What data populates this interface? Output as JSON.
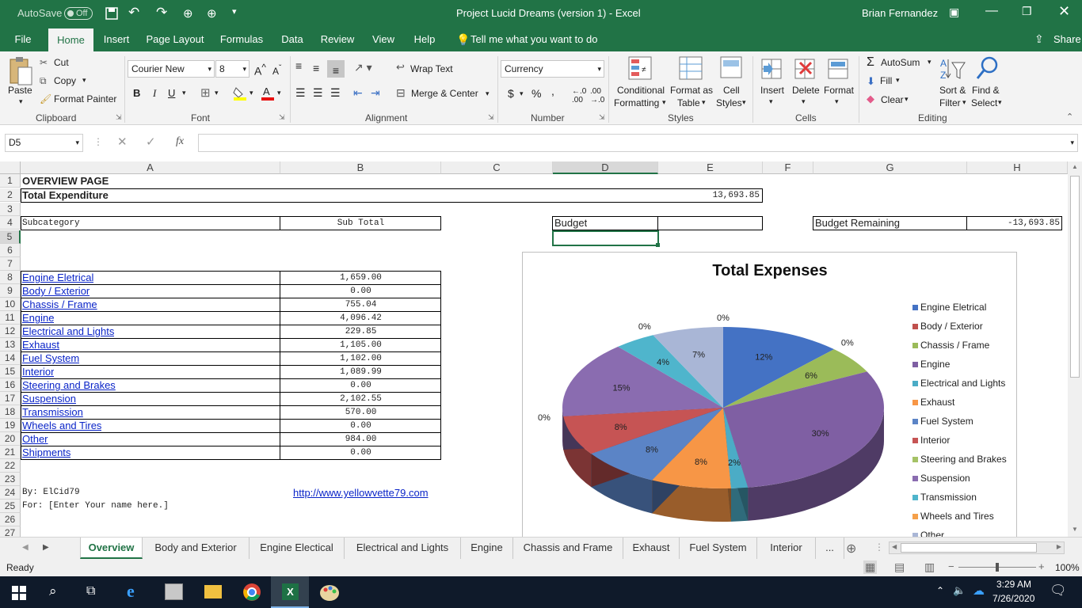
{
  "title_bar": {
    "autosave_label": "AutoSave",
    "autosave_state": "Off",
    "document_title": "Project Lucid Dreams (version 1)  -  Excel",
    "user_name": "Brian Fernandez"
  },
  "menu_tabs": [
    "File",
    "Home",
    "Insert",
    "Page Layout",
    "Formulas",
    "Data",
    "Review",
    "View",
    "Help"
  ],
  "tell_me": "Tell me what you want to do",
  "share_label": "Share",
  "ribbon": {
    "clipboard": {
      "paste": "Paste",
      "cut": "Cut",
      "copy": "Copy",
      "format_painter": "Format Painter",
      "label": "Clipboard"
    },
    "font": {
      "font_name": "Courier New",
      "font_size": "8",
      "bold": "B",
      "italic": "I",
      "underline": "U",
      "label": "Font"
    },
    "alignment": {
      "wrap_text": "Wrap Text",
      "merge_center": "Merge & Center",
      "label": "Alignment"
    },
    "number": {
      "format": "Currency",
      "currency": "$",
      "percent": "%",
      "comma": ",",
      "label": "Number"
    },
    "styles": {
      "conditional": "Conditional",
      "conditional2": "Formatting",
      "format_as": "Format as",
      "format_as2": "Table",
      "cell": "Cell",
      "cell2": "Styles",
      "label": "Styles"
    },
    "cells": {
      "insert": "Insert",
      "delete": "Delete",
      "format": "Format",
      "label": "Cells"
    },
    "editing": {
      "autosum": "AutoSum",
      "fill": "Fill",
      "clear": "Clear",
      "sort": "Sort &",
      "sort2": "Filter",
      "find": "Find &",
      "find2": "Select",
      "label": "Editing"
    }
  },
  "formula_bar": {
    "name_box": "D5",
    "fx": "fx",
    "formula": ""
  },
  "columns": [
    "A",
    "B",
    "C",
    "D",
    "E",
    "F",
    "G",
    "H"
  ],
  "rows": [
    "1",
    "2",
    "3",
    "4",
    "5",
    "6",
    "7",
    "8",
    "9",
    "10",
    "11",
    "12",
    "13",
    "14",
    "15",
    "16",
    "17",
    "18",
    "19",
    "20",
    "21",
    "22",
    "23",
    "24",
    "25",
    "26",
    "27"
  ],
  "sheet": {
    "overview": "OVERVIEW PAGE",
    "total_label": "Total Expenditure",
    "total_value": "13,693.85",
    "subcategory_header": "Subcategory",
    "subtotal_header": "Sub Total",
    "budget_label": "Budget",
    "budget_value": "",
    "remaining_label": "Budget Remaining",
    "remaining_value": "-13,693.85",
    "items": [
      {
        "name": "Engine Eletrical",
        "value": "1,659.00"
      },
      {
        "name": "Body / Exterior",
        "value": "0.00"
      },
      {
        "name": "Chassis / Frame",
        "value": "755.04"
      },
      {
        "name": "Engine",
        "value": "4,096.42"
      },
      {
        "name": "Electrical and Lights",
        "value": "229.85"
      },
      {
        "name": "Exhaust",
        "value": "1,105.00"
      },
      {
        "name": "Fuel System",
        "value": "1,102.00"
      },
      {
        "name": "Interior",
        "value": "1,089.99"
      },
      {
        "name": "Steering and Brakes",
        "value": "0.00"
      },
      {
        "name": "Suspension",
        "value": "2,102.55"
      },
      {
        "name": "Transmission",
        "value": "570.00"
      },
      {
        "name": "Wheels and Tires",
        "value": "0.00"
      },
      {
        "name": "Other",
        "value": "984.00"
      },
      {
        "name": "Shipments",
        "value": "0.00"
      }
    ],
    "by_line": "By: ElCid79",
    "for_line": "For: [Enter Your name here.]",
    "website": "http://www.yellowvette79.com"
  },
  "chart_data": {
    "type": "pie",
    "title": "Total Expenses",
    "legend_position": "right",
    "categories": [
      "Engine Eletrical",
      "Body / Exterior",
      "Chassis / Frame",
      "Engine",
      "Electrical and Lights",
      "Exhaust",
      "Fuel System",
      "Interior",
      "Steering and Brakes",
      "Suspension",
      "Transmission",
      "Wheels and Tires",
      "Other",
      "Shipments"
    ],
    "values": [
      1659.0,
      0.0,
      755.04,
      4096.42,
      229.85,
      1105.0,
      1102.0,
      1089.99,
      0.0,
      2102.55,
      570.0,
      0.0,
      984.0,
      0.0
    ],
    "data_labels": [
      "12%",
      "0%",
      "6%",
      "30%",
      "2%",
      "8%",
      "8%",
      "8%",
      "0%",
      "15%",
      "4%",
      "0%",
      "7%",
      "0%"
    ],
    "colors": [
      "#4472c4",
      "#c0504d",
      "#9bbb59",
      "#7f5fa3",
      "#4bacc6",
      "#f79646",
      "#5b84c6",
      "#c65454",
      "#a5c266",
      "#8a6cb0",
      "#4fb5cc",
      "#f5a04a",
      "#a9b6d6",
      "#d4a2a0"
    ]
  },
  "sheet_tabs": [
    "Overview",
    "Body and Exterior",
    "Engine Electical",
    "Electrical and Lights",
    "Engine",
    "Chassis and Frame",
    "Exhaust",
    "Fuel System",
    "Interior",
    "..."
  ],
  "status": {
    "ready": "Ready",
    "zoom": "100%"
  },
  "taskbar": {
    "time": "3:29 AM",
    "date": "7/26/2020"
  }
}
